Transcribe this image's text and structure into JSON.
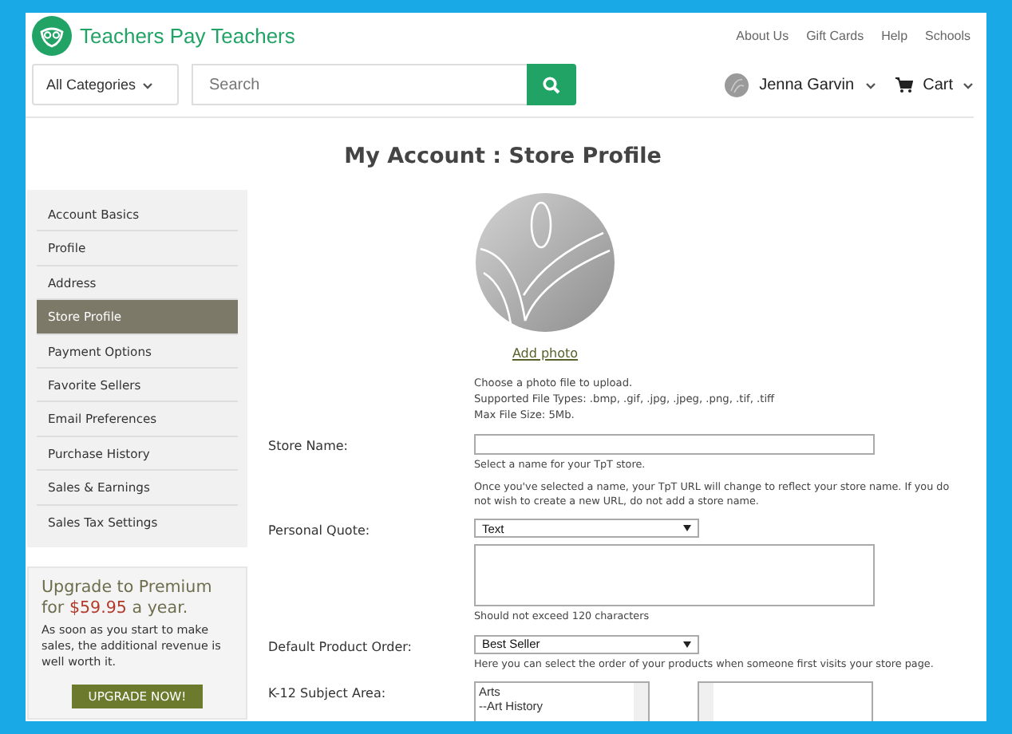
{
  "header": {
    "logo_text": "Teachers Pay Teachers",
    "top_links": [
      "About Us",
      "Gift Cards",
      "Help",
      "Schools"
    ],
    "category_select": "All Categories",
    "search": {
      "placeholder": "Search"
    },
    "user": {
      "name": "Jenna Garvin"
    },
    "cart": "Cart"
  },
  "page_title": "My Account : Store Profile",
  "sidebar": {
    "items": [
      {
        "label": "Account Basics",
        "selected": false
      },
      {
        "label": "Profile",
        "selected": false
      },
      {
        "label": "Address",
        "selected": false
      },
      {
        "label": "Store Profile",
        "selected": true
      },
      {
        "label": "Payment Options",
        "selected": false
      },
      {
        "label": "Favorite Sellers",
        "selected": false
      },
      {
        "label": "Email Preferences",
        "selected": false
      },
      {
        "label": "Purchase History",
        "selected": false
      },
      {
        "label": "Sales & Earnings",
        "selected": false
      },
      {
        "label": "Sales Tax Settings",
        "selected": false
      }
    ]
  },
  "promo": {
    "headline_start": "Upgrade to Premium for",
    "price": "$59.95",
    "headline_end": "a year.",
    "body": "As soon as you start to make sales, the additional revenue is well worth it.",
    "button": "UPGRADE NOW!"
  },
  "photo": {
    "link": "Add photo",
    "help": [
      "Choose a photo file to upload.",
      "Supported File Types: .bmp, .gif, .jpg, .jpeg, .png, .tif, .tiff",
      "Max File Size: 5Mb."
    ]
  },
  "form": {
    "rows": [
      {
        "kind": "text",
        "label": "Store Name:",
        "notes": [
          "Select a name for your TpT store.",
          "Once you've selected a name, your TpT URL will change to reflect your store name. If you do not wish to create a new URL, do not add a store name."
        ]
      },
      {
        "kind": "quote",
        "label": "Personal Quote:",
        "select": "Text",
        "notes": [
          "Should not exceed 120 characters"
        ]
      },
      {
        "kind": "select",
        "label": "Default Product Order:",
        "select": "Best Seller",
        "notes": [
          "Here you can select the order of your products when someone first visits your store page."
        ]
      },
      {
        "kind": "lists",
        "label": "K-12 Subject Area:",
        "options": [
          "Arts",
          "--Art History"
        ]
      }
    ]
  }
}
